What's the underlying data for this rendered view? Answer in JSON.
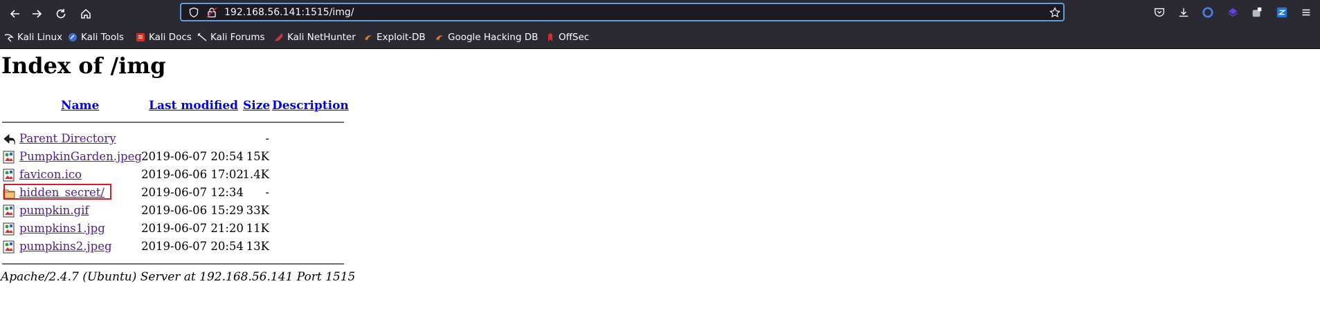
{
  "browser": {
    "url": "192.168.56.141:1515/img/",
    "bookmarks": [
      {
        "label": "Kali Linux",
        "icon": "kali-dragon-icon"
      },
      {
        "label": "Kali Tools",
        "icon": "kali-tools-icon"
      },
      {
        "label": "Kali Docs",
        "icon": "kali-docs-icon"
      },
      {
        "label": "Kali Forums",
        "icon": "kali-forums-icon"
      },
      {
        "label": "Kali NetHunter",
        "icon": "nethunter-icon"
      },
      {
        "label": "Exploit-DB",
        "icon": "exploit-db-icon"
      },
      {
        "label": "Google Hacking DB",
        "icon": "ghdb-icon"
      },
      {
        "label": "OffSec",
        "icon": "offsec-icon"
      }
    ],
    "accent": "#5f9ee6"
  },
  "page": {
    "title": "Index of /img",
    "columns": {
      "name": "Name",
      "modified": "Last modified",
      "size": "Size",
      "description": "Description"
    },
    "rows": [
      {
        "name": "Parent Directory",
        "modified": "",
        "size": "-",
        "icon": "back-arrow-icon"
      },
      {
        "name": "PumpkinGarden.jpeg",
        "modified": "2019-06-07 20:54",
        "size": "15K",
        "icon": "image-file-icon"
      },
      {
        "name": "favicon.ico",
        "modified": "2019-06-06 17:02",
        "size": "1.4K",
        "icon": "image-file-icon"
      },
      {
        "name": "hidden_secret/",
        "modified": "2019-06-07 12:34",
        "size": "-",
        "icon": "folder-icon"
      },
      {
        "name": "pumpkin.gif",
        "modified": "2019-06-06 15:29",
        "size": "33K",
        "icon": "image-file-icon"
      },
      {
        "name": "pumpkins1.jpg",
        "modified": "2019-06-07 21:20",
        "size": "11K",
        "icon": "image-file-icon"
      },
      {
        "name": "pumpkins2.jpeg",
        "modified": "2019-06-07 20:54",
        "size": "13K",
        "icon": "image-file-icon"
      }
    ],
    "highlight_color": "#e2162b",
    "server_signature": "Apache/2.4.7 (Ubuntu) Server at 192.168.56.141 Port 1515"
  }
}
